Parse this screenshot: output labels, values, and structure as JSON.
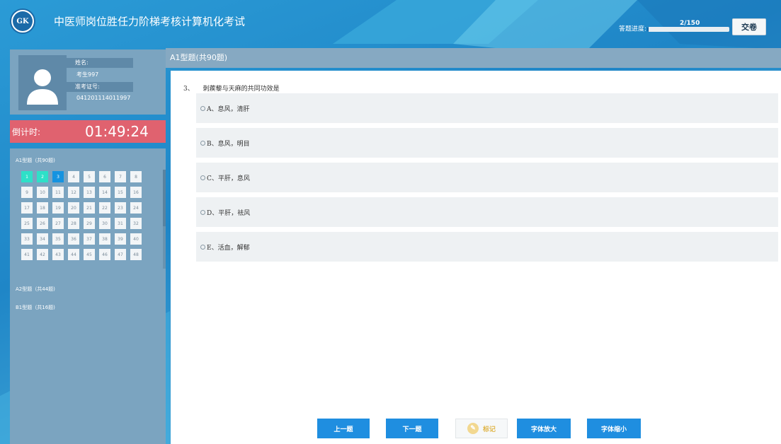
{
  "app": {
    "title": "中医师岗位胜任力阶梯考核计算机化考试",
    "logo_text": "GK"
  },
  "progress": {
    "label": "答题进度:",
    "count_text": "2/150",
    "fraction": 0.0133
  },
  "toolbar": {
    "submit_label": "交卷"
  },
  "candidate": {
    "name_label": "姓名:",
    "name_value": "考生997",
    "id_label": "准考证号:",
    "id_value": "041201114011997"
  },
  "timer": {
    "label": "倒计时:",
    "value": "01:49:24"
  },
  "nav": {
    "sections": [
      {
        "label": "A1型题（共90题)"
      },
      {
        "label": "A2型题（共44题)"
      },
      {
        "label": "B1型题（共16题)"
      }
    ],
    "questions": [
      {
        "n": "1",
        "state": "done"
      },
      {
        "n": "2",
        "state": "done"
      },
      {
        "n": "3",
        "state": "current"
      },
      {
        "n": "4",
        "state": ""
      },
      {
        "n": "5",
        "state": ""
      },
      {
        "n": "6",
        "state": ""
      },
      {
        "n": "7",
        "state": ""
      },
      {
        "n": "8",
        "state": ""
      },
      {
        "n": "9",
        "state": ""
      },
      {
        "n": "10",
        "state": ""
      },
      {
        "n": "11",
        "state": ""
      },
      {
        "n": "12",
        "state": ""
      },
      {
        "n": "13",
        "state": ""
      },
      {
        "n": "14",
        "state": ""
      },
      {
        "n": "15",
        "state": ""
      },
      {
        "n": "16",
        "state": ""
      },
      {
        "n": "17",
        "state": ""
      },
      {
        "n": "18",
        "state": ""
      },
      {
        "n": "19",
        "state": ""
      },
      {
        "n": "20",
        "state": ""
      },
      {
        "n": "21",
        "state": ""
      },
      {
        "n": "22",
        "state": ""
      },
      {
        "n": "23",
        "state": ""
      },
      {
        "n": "24",
        "state": ""
      },
      {
        "n": "25",
        "state": ""
      },
      {
        "n": "26",
        "state": ""
      },
      {
        "n": "27",
        "state": ""
      },
      {
        "n": "28",
        "state": ""
      },
      {
        "n": "29",
        "state": ""
      },
      {
        "n": "30",
        "state": ""
      },
      {
        "n": "31",
        "state": ""
      },
      {
        "n": "32",
        "state": ""
      },
      {
        "n": "33",
        "state": ""
      },
      {
        "n": "34",
        "state": ""
      },
      {
        "n": "35",
        "state": ""
      },
      {
        "n": "36",
        "state": ""
      },
      {
        "n": "37",
        "state": ""
      },
      {
        "n": "38",
        "state": ""
      },
      {
        "n": "39",
        "state": ""
      },
      {
        "n": "40",
        "state": ""
      },
      {
        "n": "41",
        "state": ""
      },
      {
        "n": "42",
        "state": ""
      },
      {
        "n": "43",
        "state": ""
      },
      {
        "n": "44",
        "state": ""
      },
      {
        "n": "45",
        "state": ""
      },
      {
        "n": "46",
        "state": ""
      },
      {
        "n": "47",
        "state": ""
      },
      {
        "n": "48",
        "state": ""
      }
    ]
  },
  "main": {
    "section_title": "A1型题(共90题)",
    "question": {
      "number": "3、",
      "text": "刺蒺藜与天麻的共同功效是",
      "options": [
        {
          "label": "A、息风，清肝"
        },
        {
          "label": "B、息风，明目"
        },
        {
          "label": "C、平肝，息风"
        },
        {
          "label": "D、平肝，祛风"
        },
        {
          "label": "E、活血，解郁"
        }
      ]
    }
  },
  "footer": {
    "prev_label": "上一题",
    "next_label": "下一题",
    "mark_label": "标记",
    "font_up_label": "字体放大",
    "font_down_label": "字体缩小"
  },
  "colors": {
    "accent": "#1f8ee0",
    "done": "#2ee0c8",
    "current": "#1593e0",
    "timer": "#e0626f"
  }
}
